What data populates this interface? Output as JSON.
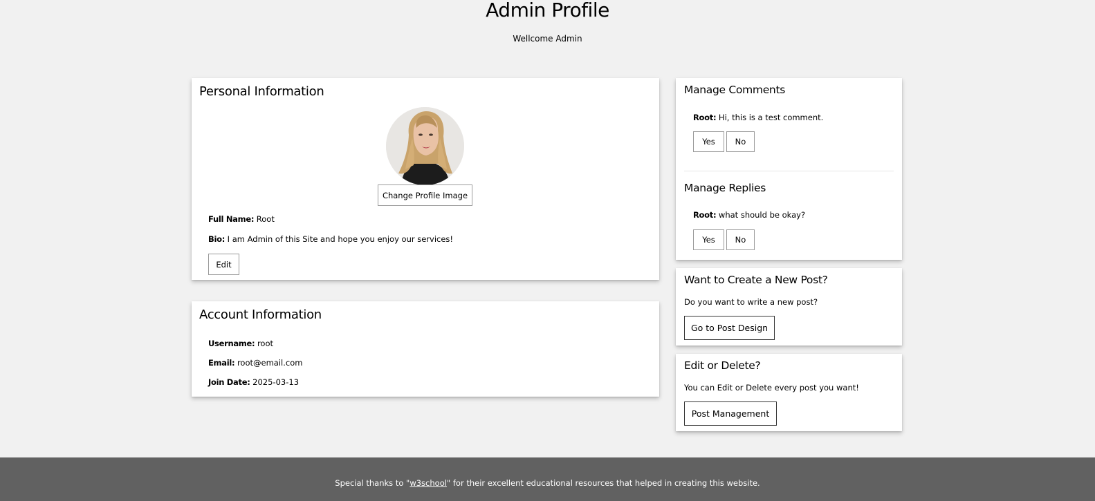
{
  "header": {
    "title": "Admin Profile",
    "subtitle": "Wellcome Admin"
  },
  "personal": {
    "title": "Personal Information",
    "change_image_label": "Change Profile Image",
    "full_name_label": "Full Name:",
    "full_name_value": "Root",
    "bio_label": "Bio:",
    "bio_value": "I am Admin of this Site and hope you enjoy our services!",
    "edit_label": "Edit"
  },
  "account": {
    "title": "Account Information",
    "username_label": "Username:",
    "username_value": "root",
    "email_label": "Email:",
    "email_value": "root@email.com",
    "join_label": "Join Date:",
    "join_value": "2025-03-13"
  },
  "comments": {
    "title": "Manage Comments",
    "author": "Root:",
    "text": "Hi, this is a test comment.",
    "yes_label": "Yes",
    "no_label": "No"
  },
  "replies": {
    "title": "Manage Replies",
    "author": "Root:",
    "text": "what should be okay?",
    "yes_label": "Yes",
    "no_label": "No"
  },
  "new_post": {
    "title": "Want to Create a New Post?",
    "text": "Do you want to write a new post?",
    "button_label": "Go to Post Design"
  },
  "edit_delete": {
    "title": "Edit or Delete?",
    "text": "You can Edit or Delete every post you want!",
    "button_label": "Post Management"
  },
  "footer": {
    "prefix": "Special thanks to \"",
    "link_text": "w3school",
    "suffix": "\" for their excellent educational resources that helped in creating this website."
  },
  "colors": {
    "page_bg": "#f1f1f1",
    "footer_bg": "#616161",
    "card_bg": "#ffffff"
  }
}
